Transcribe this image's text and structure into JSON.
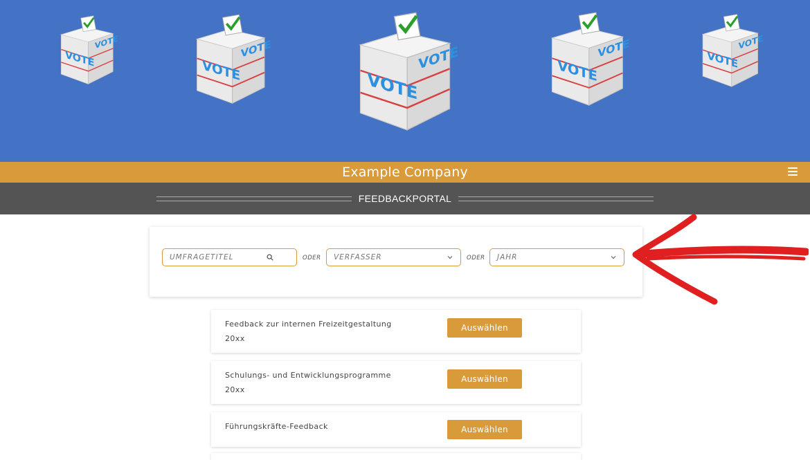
{
  "hero": {
    "box_label": "VOTE"
  },
  "header": {
    "company_name": "Example Company",
    "menu_icon": "hamburger-menu-icon"
  },
  "portal": {
    "title": "FEEDBACKPORTAL"
  },
  "filters": {
    "title_placeholder": "UMFRAGETITEL",
    "author_placeholder": "VERFASSER",
    "year_placeholder": "JAHR",
    "separator": "ODER",
    "search_icon": "search-icon",
    "dropdown_icon": "chevron-down-icon"
  },
  "surveys": [
    {
      "title": "Feedback zur internen Freizeitgestaltung 20xx",
      "button": "Auswählen"
    },
    {
      "title": "Schulungs- und Entwicklungsprogramme 20xx",
      "button": "Auswählen"
    },
    {
      "title": "Führungskräfte-Feedback",
      "button": "Auswählen"
    }
  ],
  "colors": {
    "hero_bg": "#4472c4",
    "accent": "#d99a3a",
    "portal_bg": "#545454",
    "arrow": "#e02020"
  }
}
